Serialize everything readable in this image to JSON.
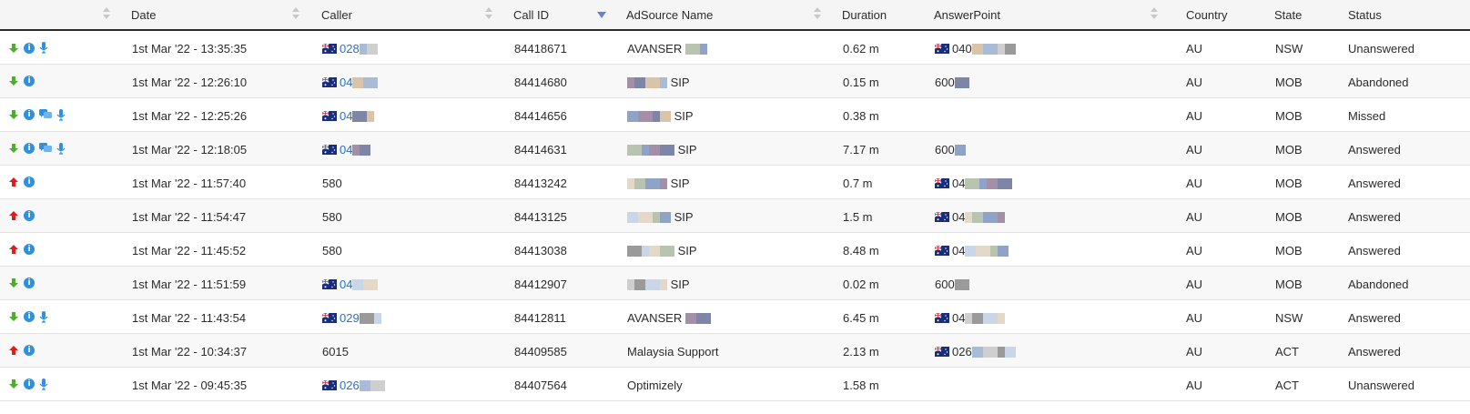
{
  "columns": {
    "date": "Date",
    "caller": "Caller",
    "call_id": "Call ID",
    "adsource": "AdSource Name",
    "duration": "Duration",
    "answerpoint": "AnswerPoint",
    "country": "Country",
    "state": "State",
    "status": "Status"
  },
  "colors": {
    "inbound": "#4caf2a",
    "outbound": "#e01c1c",
    "info": "#2f8fe0",
    "link": "#2a6fc9",
    "sort_active": "#6b7fd7"
  },
  "rows": [
    {
      "dir": "in",
      "chat": false,
      "mic": true,
      "date": "1st Mar '22 - 13:35:35",
      "caller_flag": true,
      "caller": "028",
      "call_id": "84418671",
      "adsource": "AVANSER",
      "duration": "0.62 m",
      "ap_flag": true,
      "answerpoint": "040",
      "country": "AU",
      "state": "NSW",
      "status": "Unanswered"
    },
    {
      "dir": "in",
      "chat": false,
      "mic": false,
      "date": "1st Mar '22 - 12:26:10",
      "caller_flag": true,
      "caller": "04",
      "call_id": "84414680",
      "adsource": "SIP",
      "duration": "0.15 m",
      "ap_flag": false,
      "answerpoint": "600",
      "country": "AU",
      "state": "MOB",
      "status": "Abandoned"
    },
    {
      "dir": "in",
      "chat": true,
      "mic": true,
      "date": "1st Mar '22 - 12:25:26",
      "caller_flag": true,
      "caller": "04",
      "call_id": "84414656",
      "adsource": "SIP",
      "duration": "0.38 m",
      "ap_flag": false,
      "answerpoint": "",
      "country": "AU",
      "state": "MOB",
      "status": "Missed"
    },
    {
      "dir": "in",
      "chat": true,
      "mic": true,
      "date": "1st Mar '22 - 12:18:05",
      "caller_flag": true,
      "caller": "04",
      "call_id": "84414631",
      "adsource": "SIP",
      "duration": "7.17 m",
      "ap_flag": false,
      "answerpoint": "600",
      "country": "AU",
      "state": "MOB",
      "status": "Answered"
    },
    {
      "dir": "out",
      "chat": false,
      "mic": false,
      "date": "1st Mar '22 - 11:57:40",
      "caller_flag": false,
      "caller": "580",
      "call_id": "84413242",
      "adsource": "SIP",
      "duration": "0.7 m",
      "ap_flag": true,
      "answerpoint": "04",
      "country": "AU",
      "state": "MOB",
      "status": "Answered"
    },
    {
      "dir": "out",
      "chat": false,
      "mic": false,
      "date": "1st Mar '22 - 11:54:47",
      "caller_flag": false,
      "caller": "580",
      "call_id": "84413125",
      "adsource": "SIP",
      "duration": "1.5 m",
      "ap_flag": true,
      "answerpoint": "04",
      "country": "AU",
      "state": "MOB",
      "status": "Answered"
    },
    {
      "dir": "out",
      "chat": false,
      "mic": false,
      "date": "1st Mar '22 - 11:45:52",
      "caller_flag": false,
      "caller": "580",
      "call_id": "84413038",
      "adsource": "SIP",
      "duration": "8.48 m",
      "ap_flag": true,
      "answerpoint": "04",
      "country": "AU",
      "state": "MOB",
      "status": "Answered"
    },
    {
      "dir": "in",
      "chat": false,
      "mic": false,
      "date": "1st Mar '22 - 11:51:59",
      "caller_flag": true,
      "caller": "04",
      "call_id": "84412907",
      "adsource": "SIP",
      "duration": "0.02 m",
      "ap_flag": false,
      "answerpoint": "600",
      "country": "AU",
      "state": "MOB",
      "status": "Abandoned"
    },
    {
      "dir": "in",
      "chat": false,
      "mic": true,
      "date": "1st Mar '22 - 11:43:54",
      "caller_flag": true,
      "caller": "029",
      "call_id": "84412811",
      "adsource": "AVANSER",
      "duration": "6.45 m",
      "ap_flag": true,
      "answerpoint": "04",
      "country": "AU",
      "state": "NSW",
      "status": "Answered"
    },
    {
      "dir": "out",
      "chat": false,
      "mic": false,
      "date": "1st Mar '22 - 10:34:37",
      "caller_flag": false,
      "caller": "6015",
      "call_id": "84409585",
      "adsource": "Malaysia Support",
      "duration": "2.13 m",
      "ap_flag": true,
      "answerpoint": "026",
      "country": "AU",
      "state": "ACT",
      "status": "Answered"
    },
    {
      "dir": "in",
      "chat": false,
      "mic": true,
      "date": "1st Mar '22 - 09:45:35",
      "caller_flag": true,
      "caller": "026",
      "call_id": "84407564",
      "adsource": "Optimizely",
      "duration": "1.58 m",
      "ap_flag": false,
      "answerpoint": "",
      "country": "AU",
      "state": "ACT",
      "status": "Unanswered"
    }
  ]
}
